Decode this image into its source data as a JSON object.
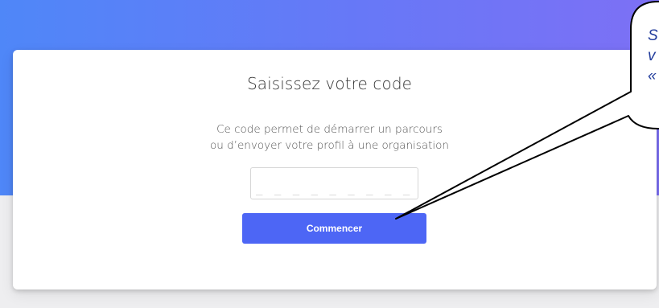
{
  "page": {
    "title": "Saisissez votre code",
    "description_line1": "Ce code permet de démarrer un parcours",
    "description_line2": "ou d’envoyer votre profil à une organisation"
  },
  "code_input": {
    "placeholder": "_ _ _ _ _ _ _ _ _",
    "value": ""
  },
  "start_button": {
    "label": "Commencer"
  },
  "callout": {
    "line1": "S",
    "line2": "v",
    "line3": "«"
  },
  "colors": {
    "accent": "#4d66f5",
    "gradient_start": "#4f87f8",
    "gradient_end": "#7d70f5",
    "callout_text": "#1f3a9b"
  }
}
